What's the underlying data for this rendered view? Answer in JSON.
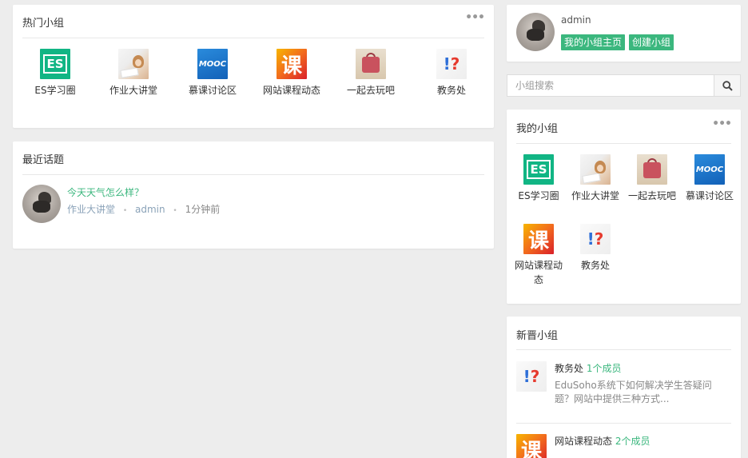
{
  "hot_groups": {
    "title": "热门小组",
    "more_icon": "ellipsis-icon",
    "items": [
      {
        "name": "ES学习圈",
        "icon": "es-logo"
      },
      {
        "name": "作业大讲堂",
        "icon": "student-photo"
      },
      {
        "name": "慕课讨论区",
        "icon": "mooc-logo"
      },
      {
        "name": "网站课程动态",
        "icon": "ke-character"
      },
      {
        "name": "一起去玩吧",
        "icon": "suitcase-photo"
      },
      {
        "name": "教务处",
        "icon": "question-exclaim"
      }
    ]
  },
  "recent_topics": {
    "title": "最近话题",
    "items": [
      {
        "title": "今天天气怎么样？",
        "group": "作业大讲堂",
        "author": "admin",
        "time": "1分钟前",
        "sep": "•"
      }
    ]
  },
  "user": {
    "name": "admin",
    "my_home_btn": "我的小组主页",
    "create_btn": "创建小组"
  },
  "search": {
    "placeholder": "小组搜索",
    "icon": "search-icon"
  },
  "my_groups": {
    "title": "我的小组",
    "more_icon": "ellipsis-icon",
    "items": [
      {
        "name": "ES学习圈",
        "icon": "es-logo"
      },
      {
        "name": "作业大讲堂",
        "icon": "student-photo"
      },
      {
        "name": "一起去玩吧",
        "icon": "suitcase-photo"
      },
      {
        "name": "慕课讨论区",
        "icon": "mooc-logo"
      },
      {
        "name": "网站课程动态",
        "icon": "ke-character"
      },
      {
        "name": "教务处",
        "icon": "question-exclaim"
      }
    ]
  },
  "new_groups": {
    "title": "新晋小组",
    "items": [
      {
        "name": "教务处",
        "members": "1个成员",
        "desc": "EduSoho系统下如何解决学生答疑问题？网站中提供三种方式..."
      },
      {
        "name": "网站课程动态",
        "members": "2个成员",
        "desc": ""
      }
    ]
  },
  "icon_text": {
    "es": "ES",
    "mooc": "MOOC",
    "ke": "课",
    "q1": "!",
    "q2": "?"
  },
  "colors": {
    "accent": "#3bb77e",
    "background": "#ededed"
  }
}
